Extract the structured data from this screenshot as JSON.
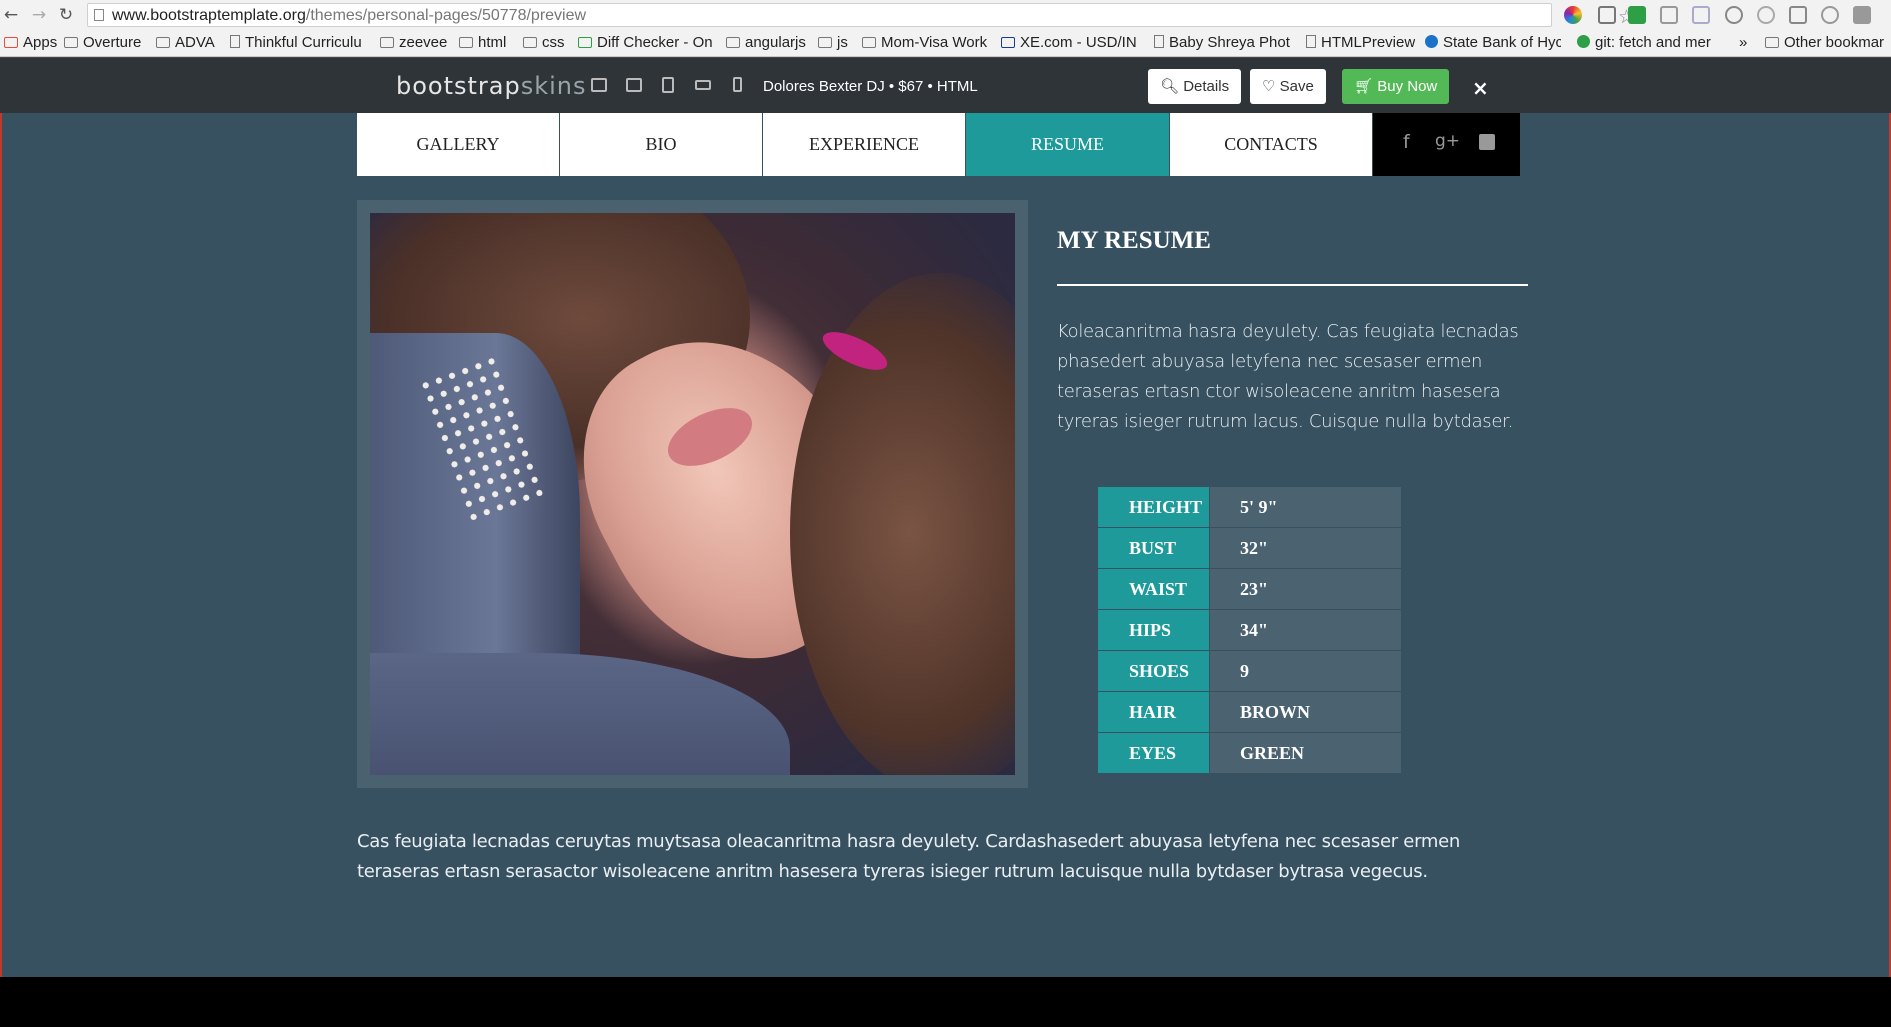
{
  "browser": {
    "url_host": "www.bootstraptemplate.org",
    "url_path": "/themes/personal-pages/50778/preview",
    "bookmarks": [
      {
        "label": "Apps",
        "icon": "apps-grid-icon"
      },
      {
        "label": "Overture",
        "icon": "folder-icon"
      },
      {
        "label": "ADVA",
        "icon": "folder-icon"
      },
      {
        "label": "Thinkful Curriculu",
        "icon": "page-icon"
      },
      {
        "label": "zeevee",
        "icon": "folder-icon"
      },
      {
        "label": "html",
        "icon": "folder-icon"
      },
      {
        "label": "css",
        "icon": "folder-icon"
      },
      {
        "label": "Diff Checker - On",
        "icon": "diffchecker-icon"
      },
      {
        "label": "angularjs",
        "icon": "folder-icon"
      },
      {
        "label": "js",
        "icon": "folder-icon"
      },
      {
        "label": "Mom-Visa Work",
        "icon": "folder-icon"
      },
      {
        "label": "XE.com - USD/INI",
        "icon": "xe-icon"
      },
      {
        "label": "Baby Shreya Phot",
        "icon": "page-icon"
      },
      {
        "label": "HTMLPreview",
        "icon": "page-icon"
      },
      {
        "label": "State Bank of Hyc",
        "icon": "bank-icon"
      },
      {
        "label": "git: fetch and mer",
        "icon": "git-icon"
      },
      {
        "label": "»",
        "icon": ""
      },
      {
        "label": "Other bookmar",
        "icon": "folder-icon"
      }
    ]
  },
  "preview_bar": {
    "brand_main": "bootstrap",
    "brand_accent": "skins",
    "title": "Dolores Bexter DJ • $67 • HTML",
    "details_label": "Details",
    "save_label": "Save",
    "buy_label": "Buy Now",
    "close_label": "×"
  },
  "nav": {
    "items": [
      "GALLERY",
      "BIO",
      "EXPERIENCE",
      "RESUME",
      "CONTACTS"
    ],
    "active": "RESUME",
    "social": [
      "f",
      "g+",
      "twitter"
    ]
  },
  "resume": {
    "title": "MY RESUME",
    "intro": "Koleacanritma hasra deyulety. Cas feugiata lecnadas phasedert abuyasa letyfena nec scesaser ermen teraseras ertasn ctor wisoleacene anritm hasesera tyreras isieger rutrum lacus. Cuisque nulla bytdaser.",
    "stats": [
      {
        "label": "HEIGHT",
        "value": "5' 9\""
      },
      {
        "label": "BUST",
        "value": "32\""
      },
      {
        "label": "WAIST",
        "value": "23\""
      },
      {
        "label": "HIPS",
        "value": "34\""
      },
      {
        "label": "SHOES",
        "value": "9"
      },
      {
        "label": "HAIR",
        "value": "BROWN"
      },
      {
        "label": "EYES",
        "value": "GREEN"
      }
    ],
    "body": "Cas feugiata lecnadas ceruytas muytsasa oleacanritma hasra deyulety. Cardashasedert abuyasa letyfena nec scesaser ermen teraseras ertasn serasactor wisoleacene anritm hasesera tyreras isieger rutrum lacuisque nulla bytdaser bytrasa vegecus."
  },
  "colors": {
    "page_bg": "#375161",
    "accent": "#1f9a9a",
    "buy_green": "#53b957"
  }
}
